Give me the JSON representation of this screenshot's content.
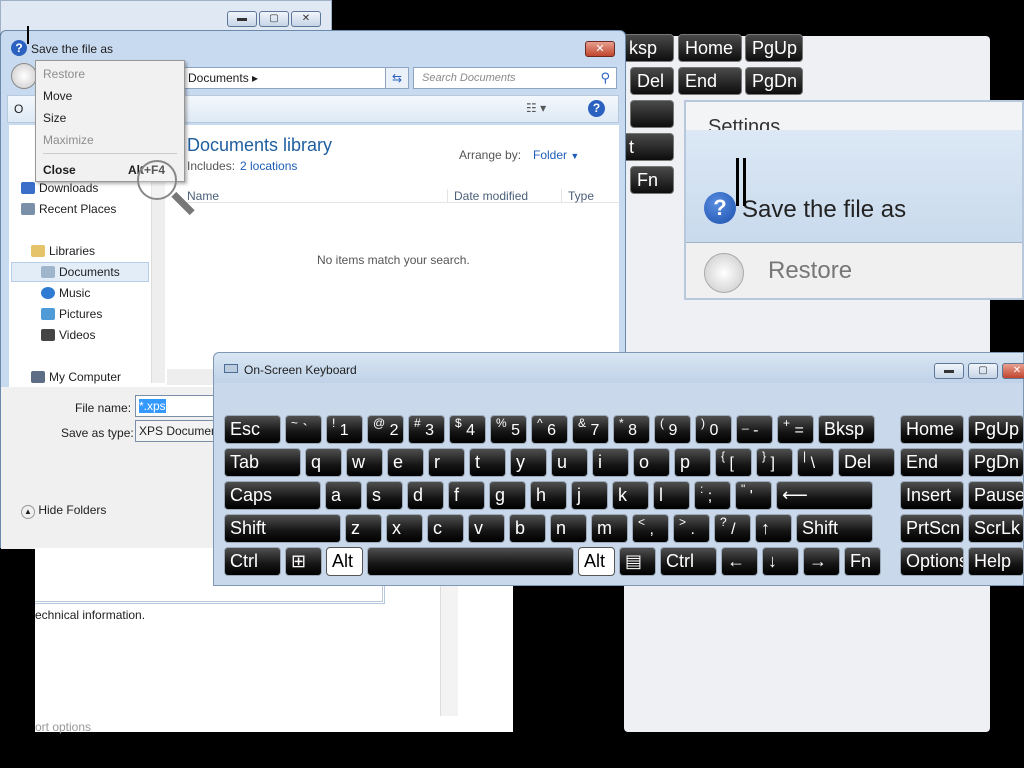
{
  "background": {
    "top_window_controls": [
      "▬",
      "▢",
      "✕"
    ],
    "ghost_keys": [
      "ksp",
      "Home",
      "PgUp",
      "Del",
      "End",
      "PgDn",
      "t",
      "Fn"
    ],
    "magnifier": {
      "title": "Save the file as",
      "partial_text": "Settings",
      "restore": "Restore"
    },
    "lower_window": {
      "text": "echnical information.",
      "link": "ort options"
    }
  },
  "dialog": {
    "title": "Save the file as",
    "close_label": "✕",
    "address": "Documents",
    "search_placeholder": "Search Documents",
    "library_title": "Documents library",
    "includes_label": "Includes:",
    "includes_link": "2 locations",
    "arrange_label": "Arrange by:",
    "arrange_value": "Folder",
    "columns": [
      "Name",
      "Date modified",
      "Type"
    ],
    "empty_message": "No items match your search.",
    "nav_items": [
      {
        "label": "Downloads",
        "icon": "downloads-icon"
      },
      {
        "label": "Recent Places",
        "icon": "recent-places-icon"
      },
      {
        "label": "Libraries",
        "icon": "libraries-icon"
      },
      {
        "label": "Documents",
        "icon": "documents-icon"
      },
      {
        "label": "Music",
        "icon": "music-icon"
      },
      {
        "label": "Pictures",
        "icon": "pictures-icon"
      },
      {
        "label": "Videos",
        "icon": "videos-icon"
      },
      {
        "label": "My Computer",
        "icon": "computer-icon"
      }
    ],
    "file_name_label": "File name:",
    "file_name_value": "*.xps",
    "save_type_label": "Save as type:",
    "save_type_value": "XPS Document",
    "hide_folders": "Hide Folders",
    "toolbar_partial": "O"
  },
  "context_menu": [
    {
      "label": "Restore",
      "enabled": false
    },
    {
      "label": "Move",
      "enabled": true
    },
    {
      "label": "Size",
      "enabled": true
    },
    {
      "label": "Maximize",
      "enabled": false
    },
    {
      "label": "Close",
      "enabled": true,
      "shortcut": "Alt+F4"
    }
  ],
  "keyboard": {
    "title": "On-Screen Keyboard",
    "rows": [
      [
        "Esc",
        "~ `",
        "! 1",
        "@ 2",
        "# 3",
        "$ 4",
        "% 5",
        "^ 6",
        "& 7",
        "* 8",
        "( 9",
        ") 0",
        "_ -",
        "+ =",
        "Bksp",
        "Home",
        "PgUp"
      ],
      [
        "Tab",
        "q",
        "w",
        "e",
        "r",
        "t",
        "y",
        "u",
        "i",
        "o",
        "p",
        "{ [",
        "} ]",
        "| \\",
        "Del",
        "End",
        "PgDn"
      ],
      [
        "Caps",
        "a",
        "s",
        "d",
        "f",
        "g",
        "h",
        "j",
        "k",
        "l",
        ": ;",
        "\" '",
        "⟵",
        "Insert",
        "Pause"
      ],
      [
        "Shift",
        "z",
        "x",
        "c",
        "v",
        "b",
        "n",
        "m",
        "< ,",
        "> .",
        "? /",
        "↑",
        "Shift",
        "PrtScn",
        "ScrLk"
      ],
      [
        "Ctrl",
        "⊞",
        "Alt",
        "",
        "Alt",
        "▤",
        "Ctrl",
        "←",
        "↓",
        "→",
        "Fn",
        "Options",
        "Help"
      ]
    ]
  }
}
